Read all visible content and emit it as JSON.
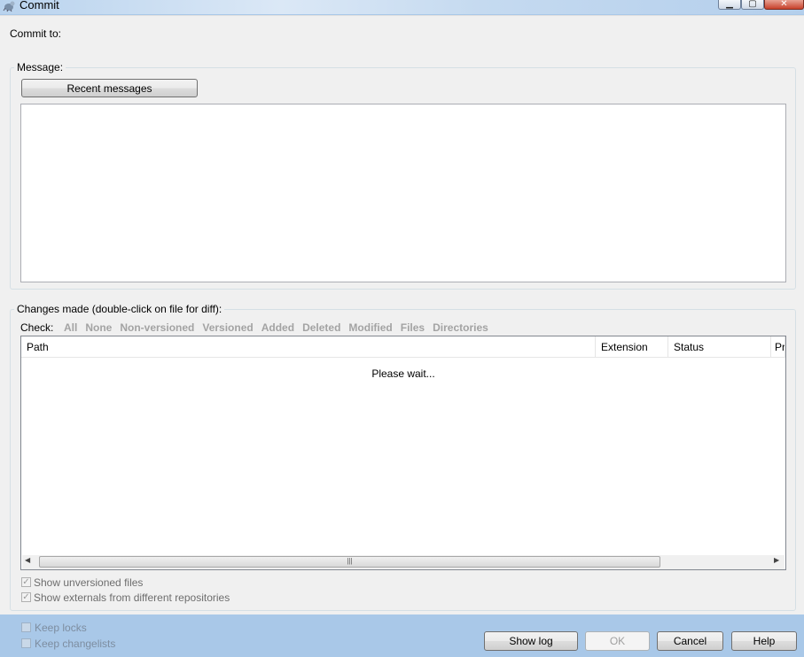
{
  "window": {
    "title": "Commit"
  },
  "commit_to": {
    "label": "Commit to:"
  },
  "message": {
    "group_label": "Message:",
    "recent_button": "Recent messages",
    "text": ""
  },
  "changes": {
    "group_label": "Changes made (double-click on file for diff):",
    "check_label": "Check:",
    "check_links": [
      "All",
      "None",
      "Non-versioned",
      "Versioned",
      "Added",
      "Deleted",
      "Modified",
      "Files",
      "Directories"
    ],
    "columns": [
      "Path",
      "Extension",
      "Status",
      "Pr"
    ],
    "status_text": "Please wait...",
    "show_unversioned": "Show unversioned files",
    "show_externals": "Show externals from different repositories"
  },
  "bottom": {
    "keep_locks": "Keep locks",
    "keep_changelists": "Keep changelists",
    "show_log": "Show log",
    "ok": "OK",
    "cancel": "Cancel",
    "help": "Help"
  },
  "icons": {
    "app": "tortoise-icon",
    "minimize": "minimize-icon",
    "maximize": "maximize-icon",
    "close": "close-icon"
  }
}
